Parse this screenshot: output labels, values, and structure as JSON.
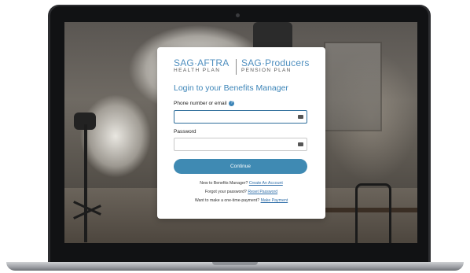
{
  "logo": {
    "left_top": "SAG·AFTRA",
    "left_bottom": "HEALTH PLAN",
    "right_top": "SAG·Producers",
    "right_bottom": "PENSION PLAN"
  },
  "login": {
    "title": "Login to your Benefits Manager",
    "email_label": "Phone number or email",
    "help_icon": "?",
    "email_value": "",
    "password_label": "Password",
    "password_value": "",
    "continue_label": "Continue"
  },
  "links": {
    "new_text": "New to Benefits Manager?",
    "create_account": "Create An Account",
    "forgot_text": "Forgot your password?",
    "reset_password": "Reset Password",
    "payment_text": "Want to make a one-time-payment?",
    "make_payment": "Make Payment"
  },
  "icons": {
    "field_icon": "keyboard-icon"
  },
  "colors": {
    "accent": "#3f8ab3",
    "link": "#2f6ea8"
  }
}
